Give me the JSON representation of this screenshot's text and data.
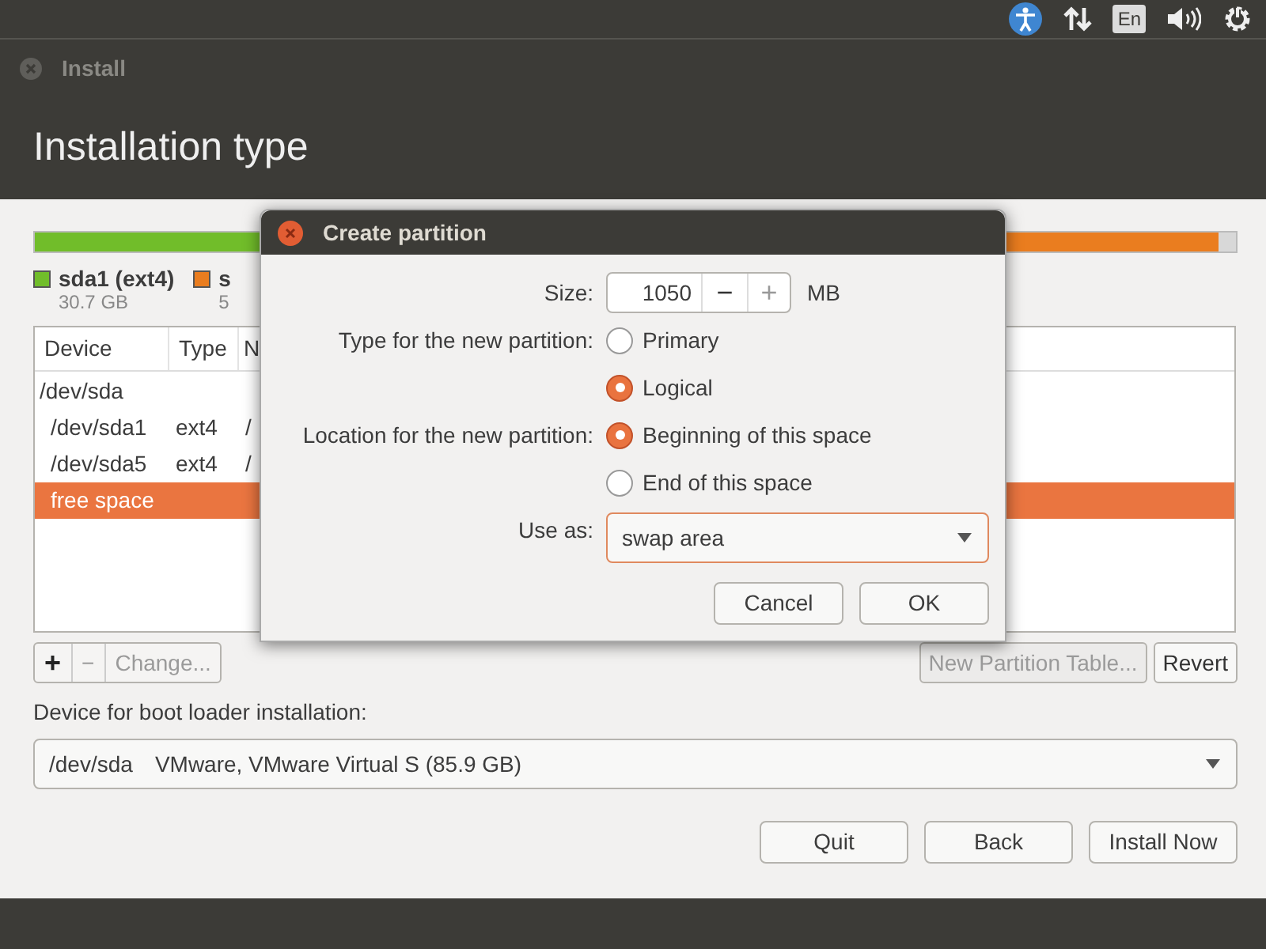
{
  "top_panel": {
    "language": "En"
  },
  "window": {
    "title": "Install"
  },
  "header": {
    "title": "Installation type"
  },
  "partition_bar": {
    "segments": [
      {
        "color": "#71bd2a",
        "level": 0.36
      },
      {
        "color": "#ea7d1f",
        "level": 0.985
      }
    ]
  },
  "legend": [
    {
      "label": "sda1 (ext4)",
      "size": "30.7 GB",
      "color": "#71bd2a"
    },
    {
      "label": "s",
      "size": "5",
      "color": "#ea7d1f"
    }
  ],
  "table": {
    "columns": [
      "Device",
      "Type",
      "N"
    ],
    "rows": [
      {
        "device": "/dev/sda",
        "selected": false,
        "children": [
          {
            "device": "/dev/sda1",
            "type": "ext4",
            "mount": "/",
            "selected": false
          },
          {
            "device": "/dev/sda5",
            "type": "ext4",
            "mount": "/",
            "selected": false
          },
          {
            "device": "free space",
            "selected": true
          }
        ]
      }
    ]
  },
  "table_toolbar": {
    "left": [
      {
        "label": "+",
        "disabled": false
      },
      {
        "label": "−",
        "disabled": true
      },
      {
        "label": "Change...",
        "disabled": true
      }
    ],
    "right": [
      {
        "label": "New Partition Table...",
        "disabled": true
      },
      {
        "label": "Revert",
        "disabled": false
      }
    ]
  },
  "boot_loader": {
    "label": "Device for boot loader installation:",
    "device": "/dev/sda",
    "description": "VMware, VMware Virtual S (85.9 GB)"
  },
  "buttons": [
    "Quit",
    "Back",
    "Install Now"
  ],
  "dialog": {
    "title": "Create partition",
    "size_label": "Size:",
    "size_value": "1050",
    "minus": "−",
    "plus": "+",
    "size_unit": "MB",
    "type_label": "Type for the new partition:",
    "type_options": [
      {
        "label": "Primary",
        "selected": false
      },
      {
        "label": "Logical",
        "selected": true
      }
    ],
    "location_label": "Location for the new partition:",
    "location_options": [
      {
        "label": "Beginning of this space",
        "selected": true
      },
      {
        "label": "End of this space",
        "selected": false
      }
    ],
    "use_as_label": "Use as:",
    "use_as_value": "swap area",
    "buttons": [
      "Cancel",
      "OK"
    ]
  }
}
